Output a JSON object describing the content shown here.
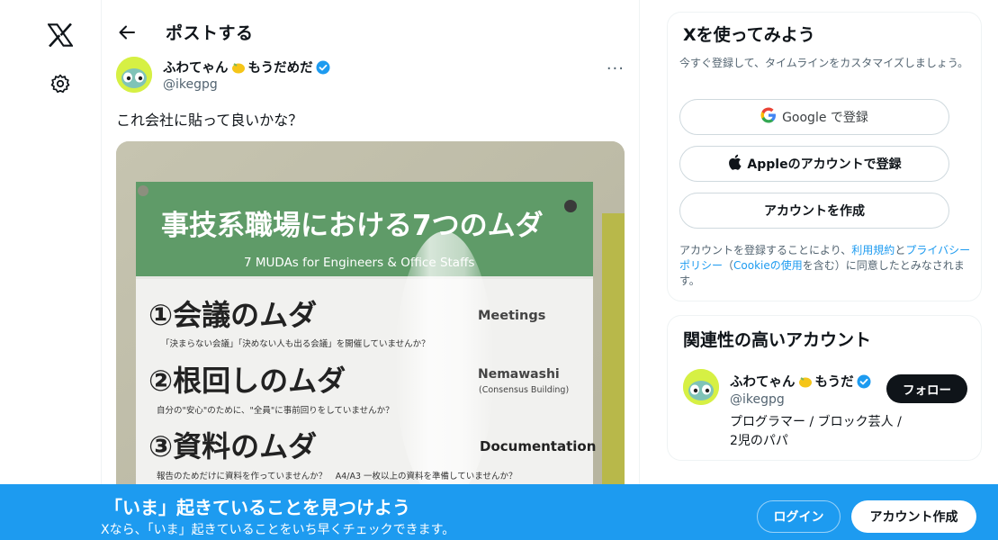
{
  "nav": {
    "logo_icon": "x-logo-icon",
    "settings_icon": "gear-icon"
  },
  "header": {
    "title": "ポストする"
  },
  "post": {
    "author_name_a": "ふわてゃん",
    "author_name_b": "もうだめだ",
    "handle": "@ikegpg",
    "text": "これ会社に貼って良いかな？",
    "more_label": "···"
  },
  "photo": {
    "title": "事技系職場における7つのムダ",
    "subtitle": "7 MUDAs for Engineers & Office Staffs",
    "items": [
      {
        "heading": "①会議のムダ",
        "english": "Meetings",
        "english_sub": "",
        "desc": "「決まらない会議」「決めない人も出る会議」を開催していませんか？"
      },
      {
        "heading": "②根回しのムダ",
        "english": "Nemawashi",
        "english_sub": "(Consensus Building)",
        "desc": "自分の\"安心\"のために、\"全員\"に事前回りをしていませんか？"
      },
      {
        "heading": "③資料のムダ",
        "english": "Documentation",
        "english_sub": "",
        "desc": "報告のためだけに資料を作っていませんか？　A4/A3 一枚以上の資料を準備していませんか？"
      }
    ]
  },
  "signup_card": {
    "title": "Xを使ってみよう",
    "subtitle": "今すぐ登録して、タイムラインをカスタマイズしましょう。",
    "google_label": "Google で登録",
    "apple_label": "Appleのアカウントで登録",
    "create_label": "アカウントを作成",
    "legal_a": "アカウントを登録することにより、",
    "legal_terms": "利用規約",
    "legal_b": "と",
    "legal_privacy": "プライバシーポリシー",
    "legal_c": "（",
    "legal_cookie": "Cookieの使用",
    "legal_d": "を含む）に同意したとみなされます。"
  },
  "related_card": {
    "title": "関連性の高いアカウント",
    "name_a": "ふわてゃん",
    "name_b": "もうだ",
    "handle": "@ikegpg",
    "bio": "プログラマー / ブロック芸人 / 2児のパパ",
    "follow_label": "フォロー"
  },
  "banner": {
    "title": "「いま」起きていることを見つけよう",
    "subtitle": "Xなら、「いま」起きていることをいち早くチェックできます。",
    "login_label": "ログイン",
    "signup_label": "アカウント作成"
  },
  "colors": {
    "accent": "#1d9bf0",
    "text": "#0f1419",
    "muted": "#536471",
    "poster_green": "#5f9b68"
  }
}
